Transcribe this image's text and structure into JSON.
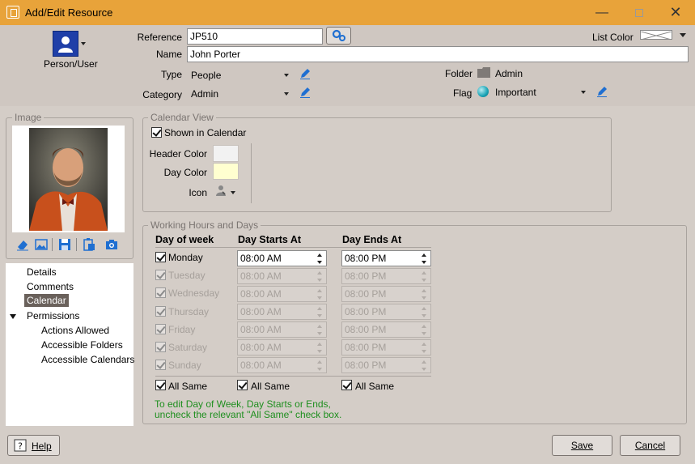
{
  "window": {
    "title": "Add/Edit Resource",
    "minimize_icon": "minimize-icon",
    "maximize_icon": "maximize-icon",
    "close_icon": "close-icon"
  },
  "header": {
    "resource_type_label": "Person/User",
    "reference_label": "Reference",
    "reference_value": "JP510",
    "name_label": "Name",
    "name_value": "John Porter",
    "list_color_label": "List Color",
    "type_label": "Type",
    "type_value": "People",
    "category_label": "Category",
    "category_value": "Admin",
    "folder_label": "Folder",
    "folder_value": "Admin",
    "flag_label": "Flag",
    "flag_value": "Important"
  },
  "image_panel": {
    "label": "Image",
    "tools": [
      "eraser-icon",
      "picture-icon",
      "save-icon",
      "paste-icon",
      "camera-icon"
    ]
  },
  "nav": {
    "items": [
      {
        "label": "Details"
      },
      {
        "label": "Comments"
      },
      {
        "label": "Calendar"
      },
      {
        "label": "Permissions"
      },
      {
        "label": "Actions Allowed"
      },
      {
        "label": "Accessible Folders"
      },
      {
        "label": "Accessible Calendars"
      }
    ],
    "selected": "Calendar"
  },
  "calendar_view": {
    "group_label": "Calendar View",
    "shown_label": "Shown in Calendar",
    "shown_checked": true,
    "header_color_label": "Header Color",
    "header_color": "#f2f2f2",
    "day_color_label": "Day Color",
    "day_color": "#ffffd0",
    "icon_label": "Icon"
  },
  "working_hours": {
    "group_label": "Working Hours and Days",
    "col_day": "Day of week",
    "col_start": "Day Starts At",
    "col_end": "Day Ends At",
    "days": [
      {
        "day": "Monday",
        "start": "08:00 AM",
        "end": "08:00 PM"
      },
      {
        "day": "Tuesday",
        "start": "08:00 AM",
        "end": "08:00 PM"
      },
      {
        "day": "Wednesday",
        "start": "08:00 AM",
        "end": "08:00 PM"
      },
      {
        "day": "Thursday",
        "start": "08:00 AM",
        "end": "08:00 PM"
      },
      {
        "day": "Friday",
        "start": "08:00 AM",
        "end": "08:00 PM"
      },
      {
        "day": "Saturday",
        "start": "08:00 AM",
        "end": "08:00 PM"
      },
      {
        "day": "Sunday",
        "start": "08:00 AM",
        "end": "08:00 PM"
      }
    ],
    "all_same_label": "All Same",
    "note_line1": "To edit Day of Week, Day Starts or Ends,",
    "note_line2": "uncheck the relevant \"All Same\" check box.",
    "note_color": "#1f8f1f"
  },
  "footer": {
    "help_label": "Help",
    "save_label": "Save",
    "cancel_label": "Cancel"
  },
  "colors": {
    "titlebar": "#e8a33a",
    "background": "#d4cdc7",
    "accent_icon": "#1f6fd1"
  }
}
